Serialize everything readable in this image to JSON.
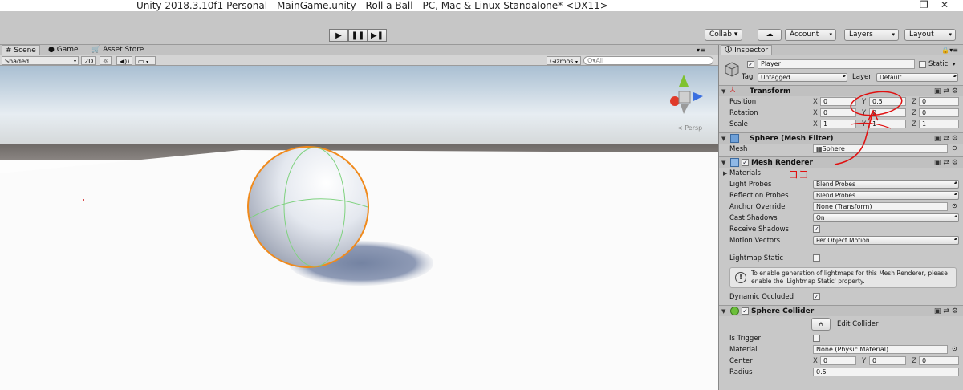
{
  "window": {
    "title": "Unity 2018.3.10f1 Personal - MainGame.unity - Roll a Ball - PC, Mac & Linux Standalone* <DX11>",
    "minimize": "_",
    "restore": "❐",
    "close": "✕"
  },
  "toolbar": {
    "play": "▶",
    "pause": "❚❚",
    "step": "▶❚",
    "collab": "Collab ▾",
    "cloud": "☁",
    "account": "Account",
    "layers": "Layers",
    "layout": "Layout"
  },
  "scene_tabs": [
    {
      "label": "# Scene"
    },
    {
      "label": "● Game"
    },
    {
      "label": "🛒 Asset Store"
    }
  ],
  "scene_bar": {
    "shading": "Shaded",
    "mode2d": "2D",
    "light": "☼",
    "audio": "◀))",
    "fx": "▭",
    "gizmos": "Gizmos",
    "search_placeholder": "Q▾All",
    "persp": "< Persp"
  },
  "inspector": {
    "tab": "Inspector",
    "object_name": "Player",
    "static_label": "Static",
    "tag_label": "Tag",
    "tag_value": "Untagged",
    "layer_label": "Layer",
    "layer_value": "Default",
    "transform": {
      "title": "Transform",
      "position": {
        "label": "Position",
        "x": "0",
        "y": "0.5",
        "z": "0"
      },
      "rotation": {
        "label": "Rotation",
        "x": "0",
        "y": "0",
        "z": "0"
      },
      "scale": {
        "label": "Scale",
        "x": "1",
        "y": "1",
        "z": "1"
      }
    },
    "mesh_filter": {
      "title": "Sphere (Mesh Filter)",
      "mesh_label": "Mesh",
      "mesh_value": "Sphere"
    },
    "mesh_renderer": {
      "title": "Mesh Renderer",
      "materials": "Materials",
      "light_probes": {
        "label": "Light Probes",
        "value": "Blend Probes"
      },
      "reflection_probes": {
        "label": "Reflection Probes",
        "value": "Blend Probes"
      },
      "anchor_override": {
        "label": "Anchor Override",
        "value": "None (Transform)"
      },
      "cast_shadows": {
        "label": "Cast Shadows",
        "value": "On"
      },
      "receive_shadows": {
        "label": "Receive Shadows"
      },
      "motion_vectors": {
        "label": "Motion Vectors",
        "value": "Per Object Motion"
      },
      "lightmap_static": {
        "label": "Lightmap Static"
      },
      "help": "To enable generation of lightmaps for this Mesh Renderer, please enable the 'Lightmap Static' property.",
      "dynamic_occluded": {
        "label": "Dynamic Occluded"
      }
    },
    "sphere_collider": {
      "title": "Sphere Collider",
      "edit_collider": "Edit Collider",
      "is_trigger": "Is Trigger",
      "material_label": "Material",
      "material_value": "None (Physic Material)",
      "center": {
        "label": "Center",
        "x": "0",
        "y": "0",
        "z": "0"
      },
      "radius": {
        "label": "Radius",
        "value": "0.5"
      }
    }
  },
  "annotation": {
    "koko": "ココ"
  },
  "colors": {
    "selection_outline": "#f08a1c",
    "annotation_red": "#e01010",
    "collider_wire": "#7fd27f"
  }
}
